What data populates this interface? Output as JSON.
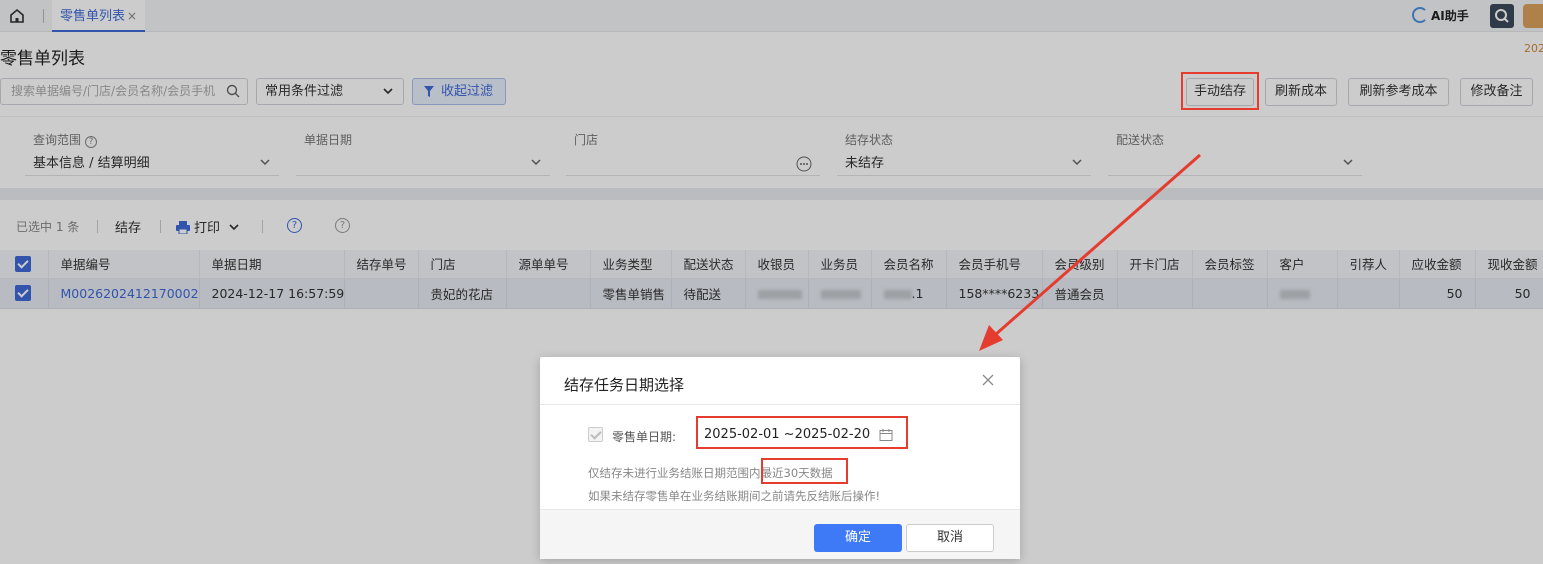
{
  "colors": {
    "accent": "#3f6ad8",
    "annotation_red": "#e43c2f",
    "confirm_button": "#3f7af6"
  },
  "top_bar": {
    "home_icon": "home-icon",
    "tab": {
      "label": "零售单列表",
      "close": "×"
    },
    "ai_assistant": "AI助手",
    "corner_year": "202"
  },
  "page": {
    "title": "零售单列表"
  },
  "toolbar": {
    "search_placeholder": "搜索单据编号/门店/会员名称/会员手机",
    "filter_select": "常用条件过滤",
    "collapse_filter": "收起过滤",
    "buttons": {
      "manual_settle": "手动结存",
      "refresh_cost": "刷新成本",
      "refresh_ref_cost": "刷新参考成本",
      "edit_remark": "修改备注"
    }
  },
  "filters": {
    "query_scope": {
      "label": "查询范围",
      "value": "基本信息 / 结算明细"
    },
    "doc_date": {
      "label": "单据日期",
      "value": ""
    },
    "store": {
      "label": "门店",
      "value": ""
    },
    "settle_status": {
      "label": "结存状态",
      "value": "未结存"
    },
    "delivery_status": {
      "label": "配送状态",
      "value": ""
    }
  },
  "actions": {
    "selected": "已选中 1 条",
    "settle": "结存",
    "print": "打印"
  },
  "table": {
    "headers": [
      "单据编号",
      "单据日期",
      "结存单号",
      "门店",
      "源单单号",
      "业务类型",
      "配送状态",
      "收银员",
      "业务员",
      "会员名称",
      "会员手机号",
      "会员级别",
      "开卡门店",
      "会员标签",
      "客户",
      "引荐人",
      "应收金额",
      "现收金额"
    ],
    "row": {
      "doc_no": "M0026202412170002",
      "doc_date": "2024-12-17 16:57:59",
      "settle_no": "",
      "store": "贵妃的花店",
      "source_no": "",
      "biz_type": "零售单销售",
      "delivery": "待配送",
      "member_name_tail": ".1",
      "member_phone": "158****6233",
      "member_level": "普通会员",
      "receivable": "50",
      "received": "50"
    }
  },
  "modal": {
    "title": "结存任务日期选择",
    "date_label": "零售单日期:",
    "date_range": "2025-02-01 ~2025-02-20",
    "note_line1": "仅结存未进行业务结账日期范围内最近30天数据",
    "note_line2": "如果未结存零售单在业务结账期间之前请先反结账后操作!",
    "ok": "确定",
    "cancel": "取消"
  }
}
